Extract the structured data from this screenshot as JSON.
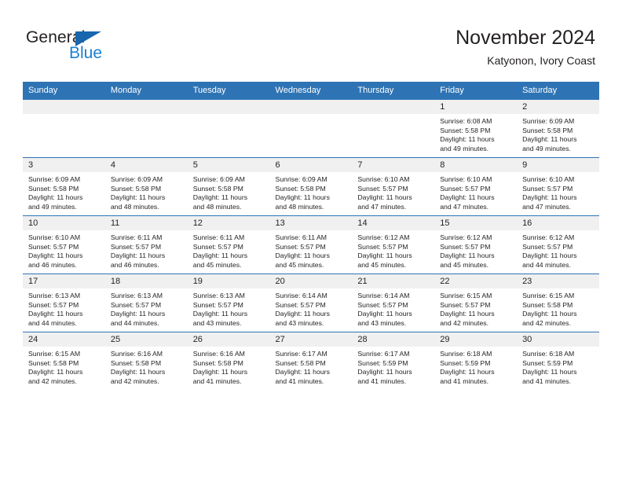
{
  "brand": {
    "name_part1": "General",
    "name_part2": "Blue",
    "accent_color": "#1a7fd4",
    "triangle_color": "#1866ae"
  },
  "header": {
    "title": "November 2024",
    "subtitle": "Katyonon, Ivory Coast"
  },
  "theme": {
    "header_bg": "#2e74b5",
    "daynum_bg": "#f0f0f0",
    "text_color": "#231f20"
  },
  "calendar": {
    "weekday_headers": [
      "Sunday",
      "Monday",
      "Tuesday",
      "Wednesday",
      "Thursday",
      "Friday",
      "Saturday"
    ],
    "labels": {
      "sunrise": "Sunrise:",
      "sunset": "Sunset:",
      "daylight": "Daylight:"
    },
    "weeks": [
      [
        {
          "day": "",
          "blank": true
        },
        {
          "day": "",
          "blank": true
        },
        {
          "day": "",
          "blank": true
        },
        {
          "day": "",
          "blank": true
        },
        {
          "day": "",
          "blank": true
        },
        {
          "day": "1",
          "sunrise": "Sunrise: 6:08 AM",
          "sunset": "Sunset: 5:58 PM",
          "daylight1": "Daylight: 11 hours",
          "daylight2": "and 49 minutes."
        },
        {
          "day": "2",
          "sunrise": "Sunrise: 6:09 AM",
          "sunset": "Sunset: 5:58 PM",
          "daylight1": "Daylight: 11 hours",
          "daylight2": "and 49 minutes."
        }
      ],
      [
        {
          "day": "3",
          "sunrise": "Sunrise: 6:09 AM",
          "sunset": "Sunset: 5:58 PM",
          "daylight1": "Daylight: 11 hours",
          "daylight2": "and 49 minutes."
        },
        {
          "day": "4",
          "sunrise": "Sunrise: 6:09 AM",
          "sunset": "Sunset: 5:58 PM",
          "daylight1": "Daylight: 11 hours",
          "daylight2": "and 48 minutes."
        },
        {
          "day": "5",
          "sunrise": "Sunrise: 6:09 AM",
          "sunset": "Sunset: 5:58 PM",
          "daylight1": "Daylight: 11 hours",
          "daylight2": "and 48 minutes."
        },
        {
          "day": "6",
          "sunrise": "Sunrise: 6:09 AM",
          "sunset": "Sunset: 5:58 PM",
          "daylight1": "Daylight: 11 hours",
          "daylight2": "and 48 minutes."
        },
        {
          "day": "7",
          "sunrise": "Sunrise: 6:10 AM",
          "sunset": "Sunset: 5:57 PM",
          "daylight1": "Daylight: 11 hours",
          "daylight2": "and 47 minutes."
        },
        {
          "day": "8",
          "sunrise": "Sunrise: 6:10 AM",
          "sunset": "Sunset: 5:57 PM",
          "daylight1": "Daylight: 11 hours",
          "daylight2": "and 47 minutes."
        },
        {
          "day": "9",
          "sunrise": "Sunrise: 6:10 AM",
          "sunset": "Sunset: 5:57 PM",
          "daylight1": "Daylight: 11 hours",
          "daylight2": "and 47 minutes."
        }
      ],
      [
        {
          "day": "10",
          "sunrise": "Sunrise: 6:10 AM",
          "sunset": "Sunset: 5:57 PM",
          "daylight1": "Daylight: 11 hours",
          "daylight2": "and 46 minutes."
        },
        {
          "day": "11",
          "sunrise": "Sunrise: 6:11 AM",
          "sunset": "Sunset: 5:57 PM",
          "daylight1": "Daylight: 11 hours",
          "daylight2": "and 46 minutes."
        },
        {
          "day": "12",
          "sunrise": "Sunrise: 6:11 AM",
          "sunset": "Sunset: 5:57 PM",
          "daylight1": "Daylight: 11 hours",
          "daylight2": "and 45 minutes."
        },
        {
          "day": "13",
          "sunrise": "Sunrise: 6:11 AM",
          "sunset": "Sunset: 5:57 PM",
          "daylight1": "Daylight: 11 hours",
          "daylight2": "and 45 minutes."
        },
        {
          "day": "14",
          "sunrise": "Sunrise: 6:12 AM",
          "sunset": "Sunset: 5:57 PM",
          "daylight1": "Daylight: 11 hours",
          "daylight2": "and 45 minutes."
        },
        {
          "day": "15",
          "sunrise": "Sunrise: 6:12 AM",
          "sunset": "Sunset: 5:57 PM",
          "daylight1": "Daylight: 11 hours",
          "daylight2": "and 45 minutes."
        },
        {
          "day": "16",
          "sunrise": "Sunrise: 6:12 AM",
          "sunset": "Sunset: 5:57 PM",
          "daylight1": "Daylight: 11 hours",
          "daylight2": "and 44 minutes."
        }
      ],
      [
        {
          "day": "17",
          "sunrise": "Sunrise: 6:13 AM",
          "sunset": "Sunset: 5:57 PM",
          "daylight1": "Daylight: 11 hours",
          "daylight2": "and 44 minutes."
        },
        {
          "day": "18",
          "sunrise": "Sunrise: 6:13 AM",
          "sunset": "Sunset: 5:57 PM",
          "daylight1": "Daylight: 11 hours",
          "daylight2": "and 44 minutes."
        },
        {
          "day": "19",
          "sunrise": "Sunrise: 6:13 AM",
          "sunset": "Sunset: 5:57 PM",
          "daylight1": "Daylight: 11 hours",
          "daylight2": "and 43 minutes."
        },
        {
          "day": "20",
          "sunrise": "Sunrise: 6:14 AM",
          "sunset": "Sunset: 5:57 PM",
          "daylight1": "Daylight: 11 hours",
          "daylight2": "and 43 minutes."
        },
        {
          "day": "21",
          "sunrise": "Sunrise: 6:14 AM",
          "sunset": "Sunset: 5:57 PM",
          "daylight1": "Daylight: 11 hours",
          "daylight2": "and 43 minutes."
        },
        {
          "day": "22",
          "sunrise": "Sunrise: 6:15 AM",
          "sunset": "Sunset: 5:57 PM",
          "daylight1": "Daylight: 11 hours",
          "daylight2": "and 42 minutes."
        },
        {
          "day": "23",
          "sunrise": "Sunrise: 6:15 AM",
          "sunset": "Sunset: 5:58 PM",
          "daylight1": "Daylight: 11 hours",
          "daylight2": "and 42 minutes."
        }
      ],
      [
        {
          "day": "24",
          "sunrise": "Sunrise: 6:15 AM",
          "sunset": "Sunset: 5:58 PM",
          "daylight1": "Daylight: 11 hours",
          "daylight2": "and 42 minutes."
        },
        {
          "day": "25",
          "sunrise": "Sunrise: 6:16 AM",
          "sunset": "Sunset: 5:58 PM",
          "daylight1": "Daylight: 11 hours",
          "daylight2": "and 42 minutes."
        },
        {
          "day": "26",
          "sunrise": "Sunrise: 6:16 AM",
          "sunset": "Sunset: 5:58 PM",
          "daylight1": "Daylight: 11 hours",
          "daylight2": "and 41 minutes."
        },
        {
          "day": "27",
          "sunrise": "Sunrise: 6:17 AM",
          "sunset": "Sunset: 5:58 PM",
          "daylight1": "Daylight: 11 hours",
          "daylight2": "and 41 minutes."
        },
        {
          "day": "28",
          "sunrise": "Sunrise: 6:17 AM",
          "sunset": "Sunset: 5:59 PM",
          "daylight1": "Daylight: 11 hours",
          "daylight2": "and 41 minutes."
        },
        {
          "day": "29",
          "sunrise": "Sunrise: 6:18 AM",
          "sunset": "Sunset: 5:59 PM",
          "daylight1": "Daylight: 11 hours",
          "daylight2": "and 41 minutes."
        },
        {
          "day": "30",
          "sunrise": "Sunrise: 6:18 AM",
          "sunset": "Sunset: 5:59 PM",
          "daylight1": "Daylight: 11 hours",
          "daylight2": "and 41 minutes."
        }
      ]
    ]
  }
}
